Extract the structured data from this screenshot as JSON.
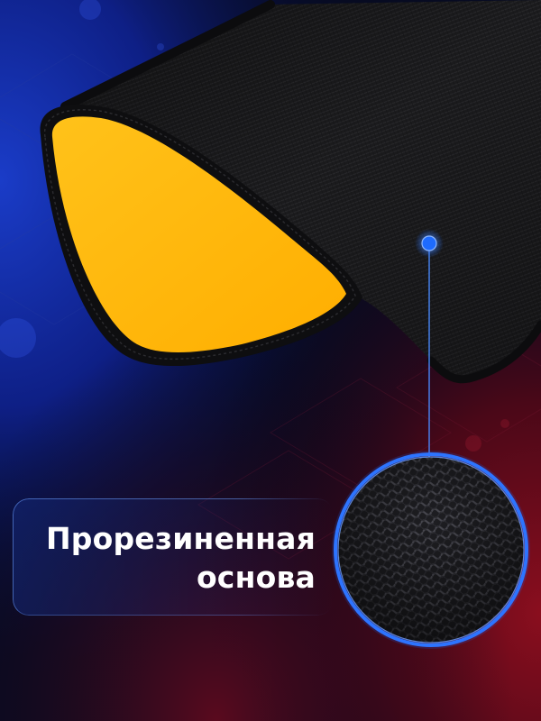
{
  "caption": {
    "line1": "Прорезиненная",
    "line2": "основа"
  },
  "colors": {
    "pad_top_surface": "#FFB800",
    "pad_base_fabric": "#1C1C1E",
    "pointer_dot": "#1E6BFF",
    "background_blue": "#0A1A6E",
    "background_red": "#6E0A16"
  },
  "illustration": {
    "subject": "mouse-pad-rolled-corner",
    "zoom_lens": "rubberized-base-texture"
  }
}
